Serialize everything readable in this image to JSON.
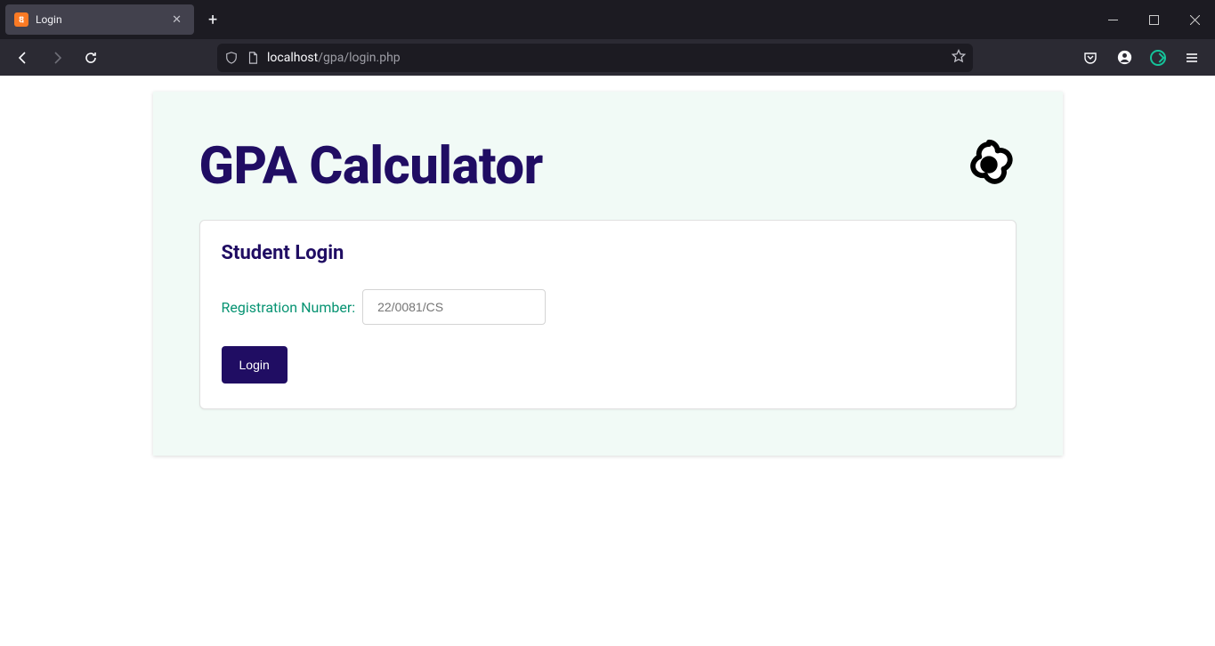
{
  "browser": {
    "tab_title": "Login",
    "url_host": "localhost",
    "url_path": "/gpa/login.php"
  },
  "header": {
    "title": "GPA Calculator"
  },
  "card": {
    "title": "Student Login",
    "reg_label": "Registration Number:",
    "reg_placeholder": "22/0081/CS",
    "login_button": "Login"
  }
}
